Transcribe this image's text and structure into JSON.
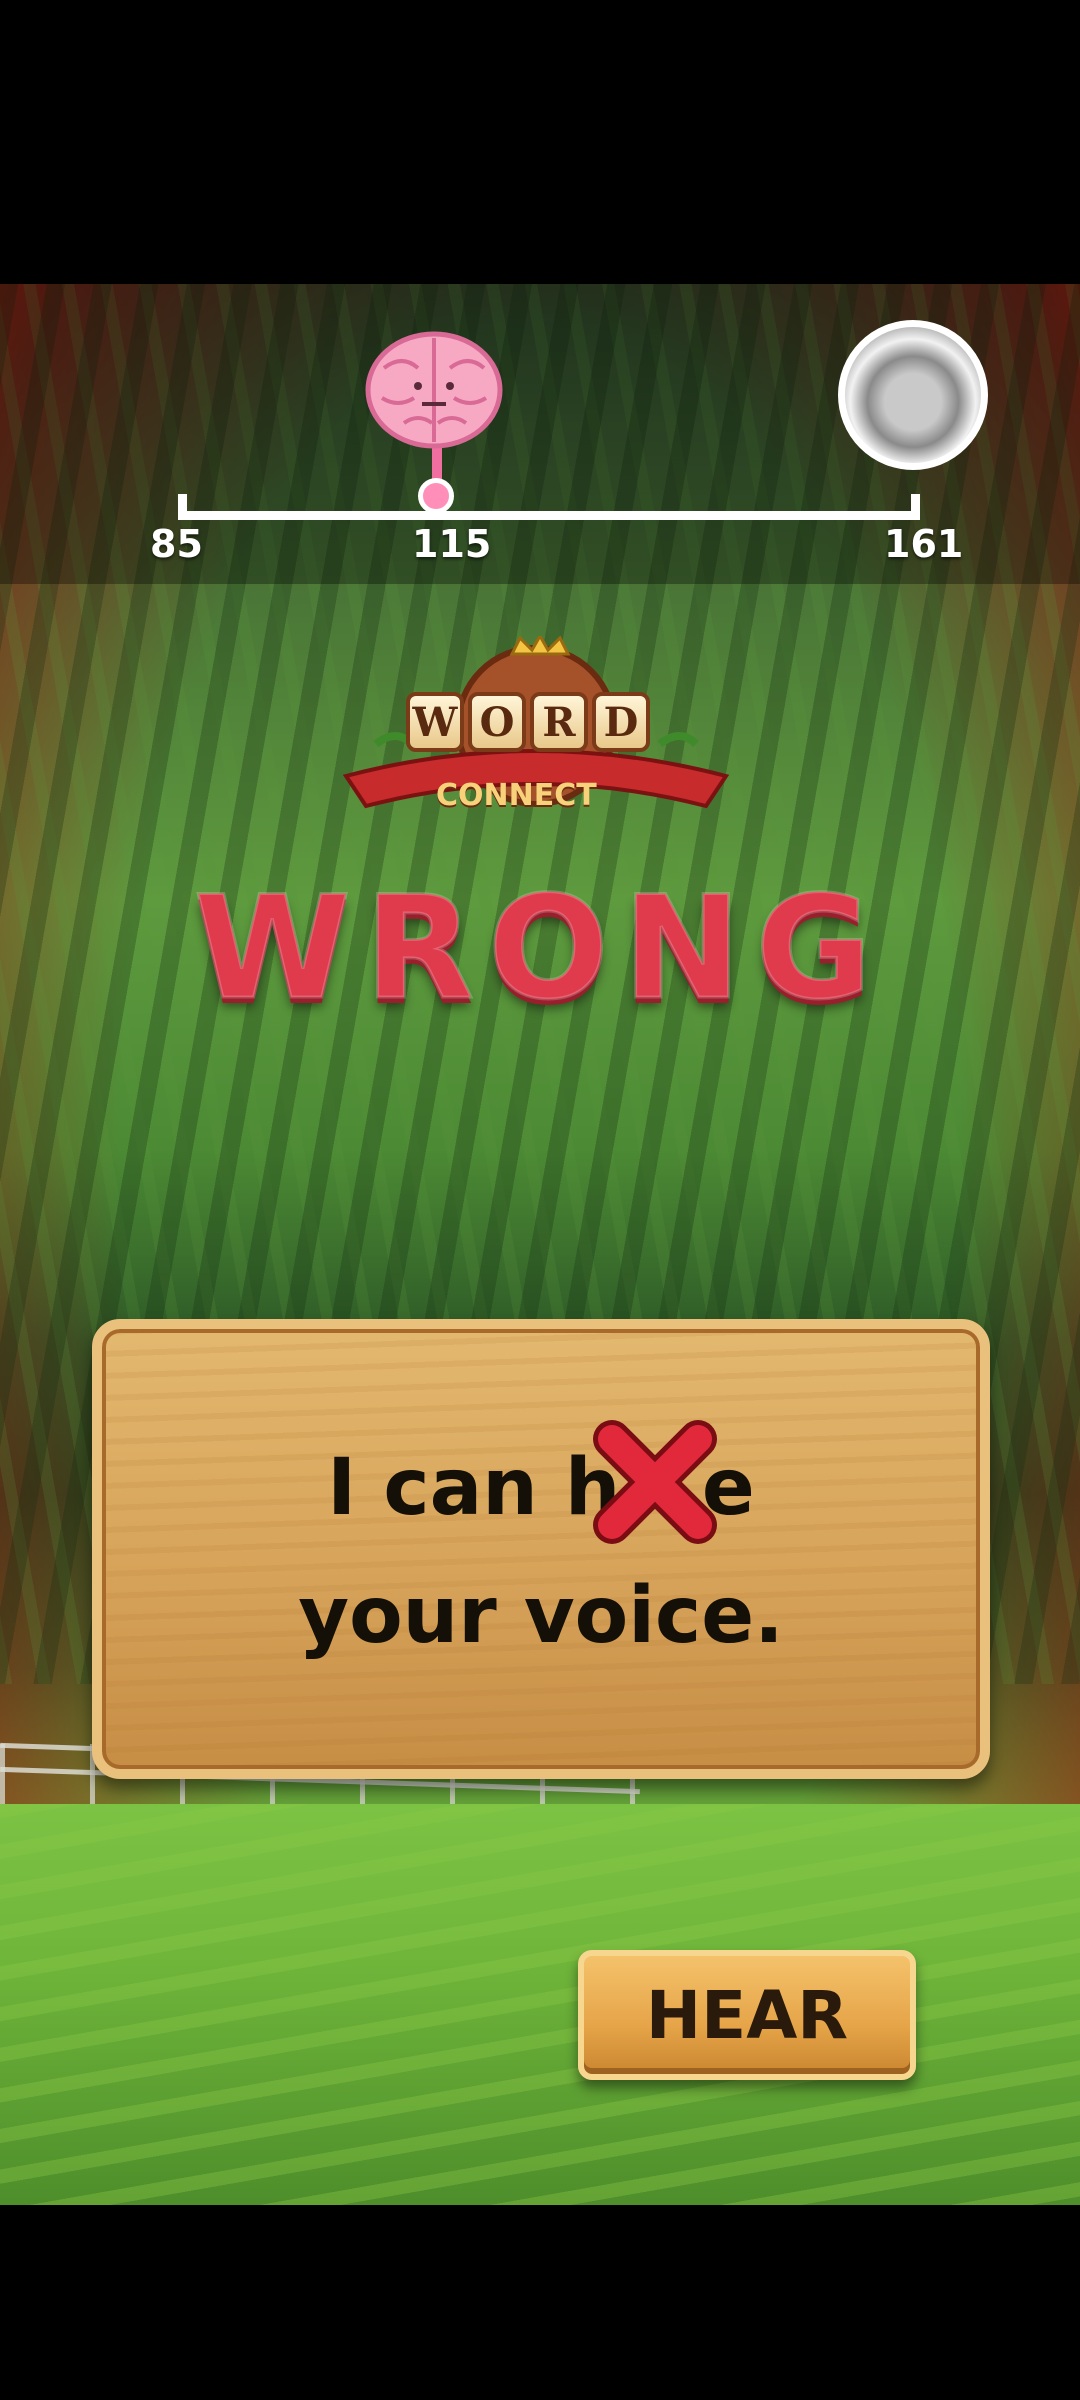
{
  "progress": {
    "start_value": "85",
    "current_value": "115",
    "goal_value": "161",
    "current_marker_value": 115
  },
  "logo": {
    "word_letters": [
      "W",
      "O",
      "R",
      "D"
    ],
    "subtitle": "CONNECT"
  },
  "result": {
    "title": "WRONG",
    "accent_color": "#e03a4d"
  },
  "puzzle": {
    "line1": "I can h   e",
    "line2": "your voice.",
    "wrong_mark_icon": "red-x-icon"
  },
  "actions": {
    "hear_label": "HEAR"
  }
}
